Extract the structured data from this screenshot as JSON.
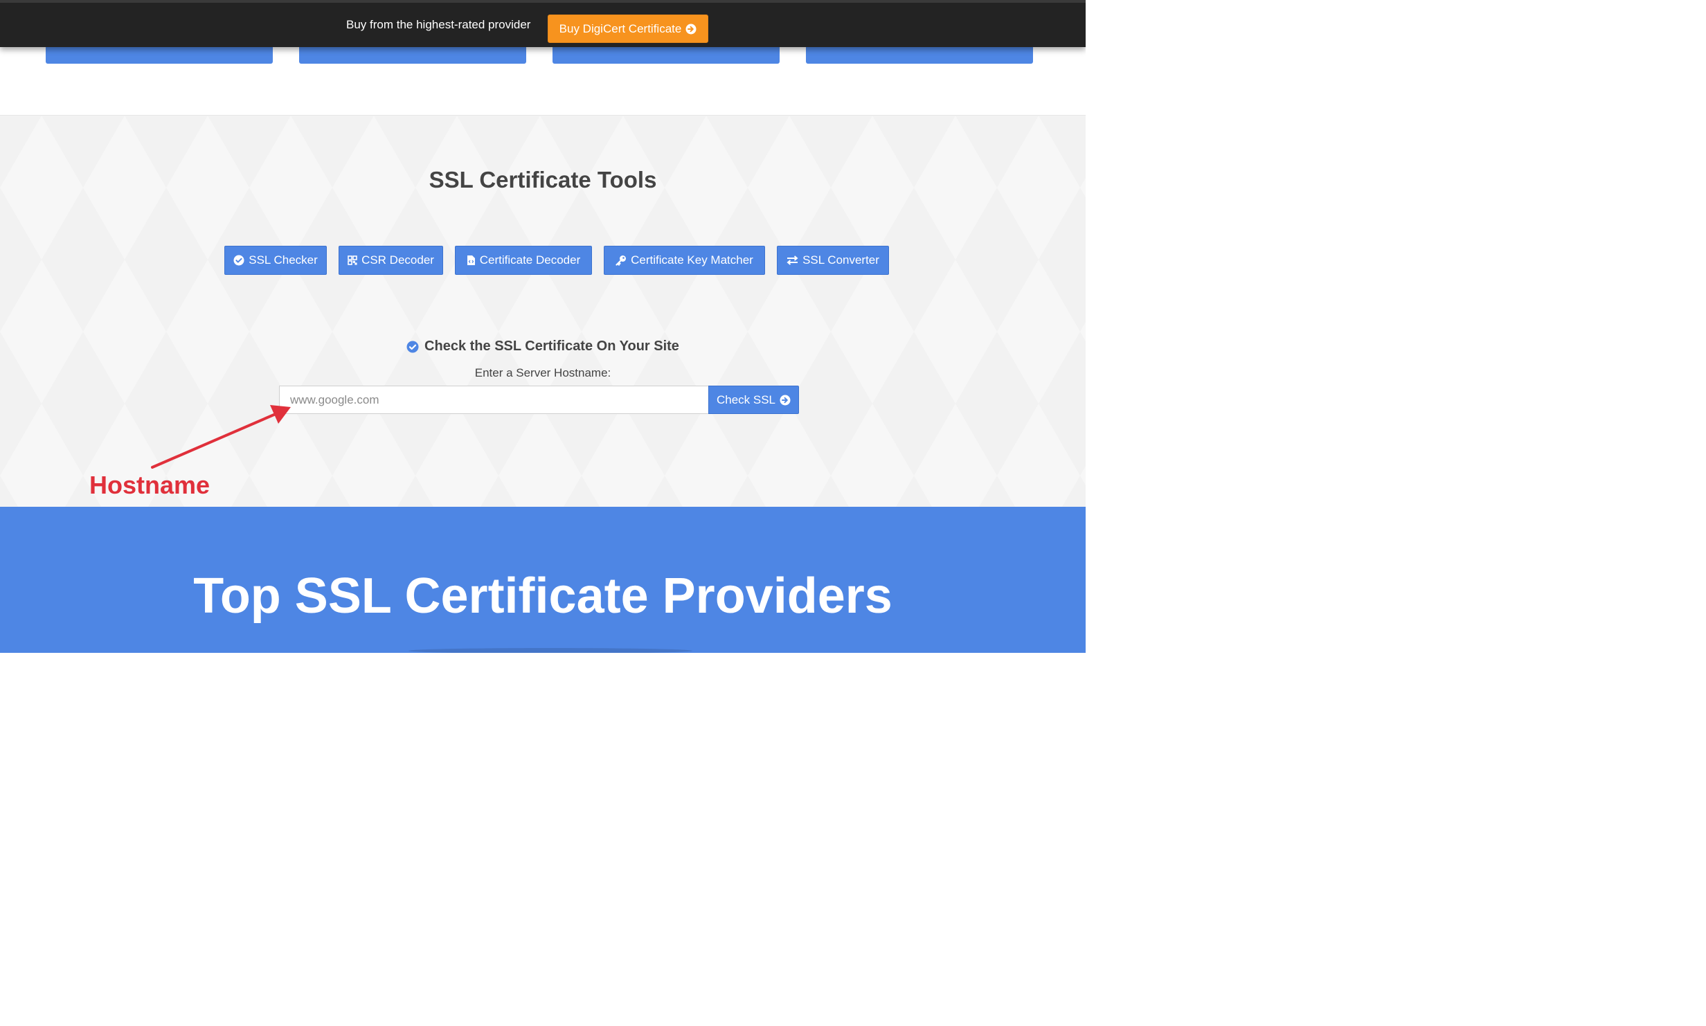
{
  "topbar": {
    "text": "Buy from the highest-rated provider",
    "button_label": "Buy DigiCert Certificate",
    "button_icon": "arrow-circle-right-icon",
    "button_color": "#f7931e"
  },
  "tools": {
    "title": "SSL Certificate Tools",
    "buttons": [
      {
        "label": "SSL Checker",
        "icon": "check-circle-icon"
      },
      {
        "label": "CSR Decoder",
        "icon": "qrcode-icon"
      },
      {
        "label": "Certificate Decoder",
        "icon": "file-code-icon"
      },
      {
        "label": "Certificate Key Matcher",
        "icon": "key-icon"
      },
      {
        "label": "SSL Converter",
        "icon": "exchange-icon"
      }
    ],
    "accent_color": "#4e86e4"
  },
  "checker": {
    "heading": "Check the SSL Certificate On Your Site",
    "label": "Enter a Server Hostname:",
    "input_placeholder": "www.google.com",
    "input_value": "",
    "button_label": "Check SSL",
    "button_icon": "arrow-circle-right-icon"
  },
  "annotation": {
    "label": "Hostname",
    "color": "#e0303b"
  },
  "providers": {
    "title": "Top SSL Certificate Providers"
  }
}
